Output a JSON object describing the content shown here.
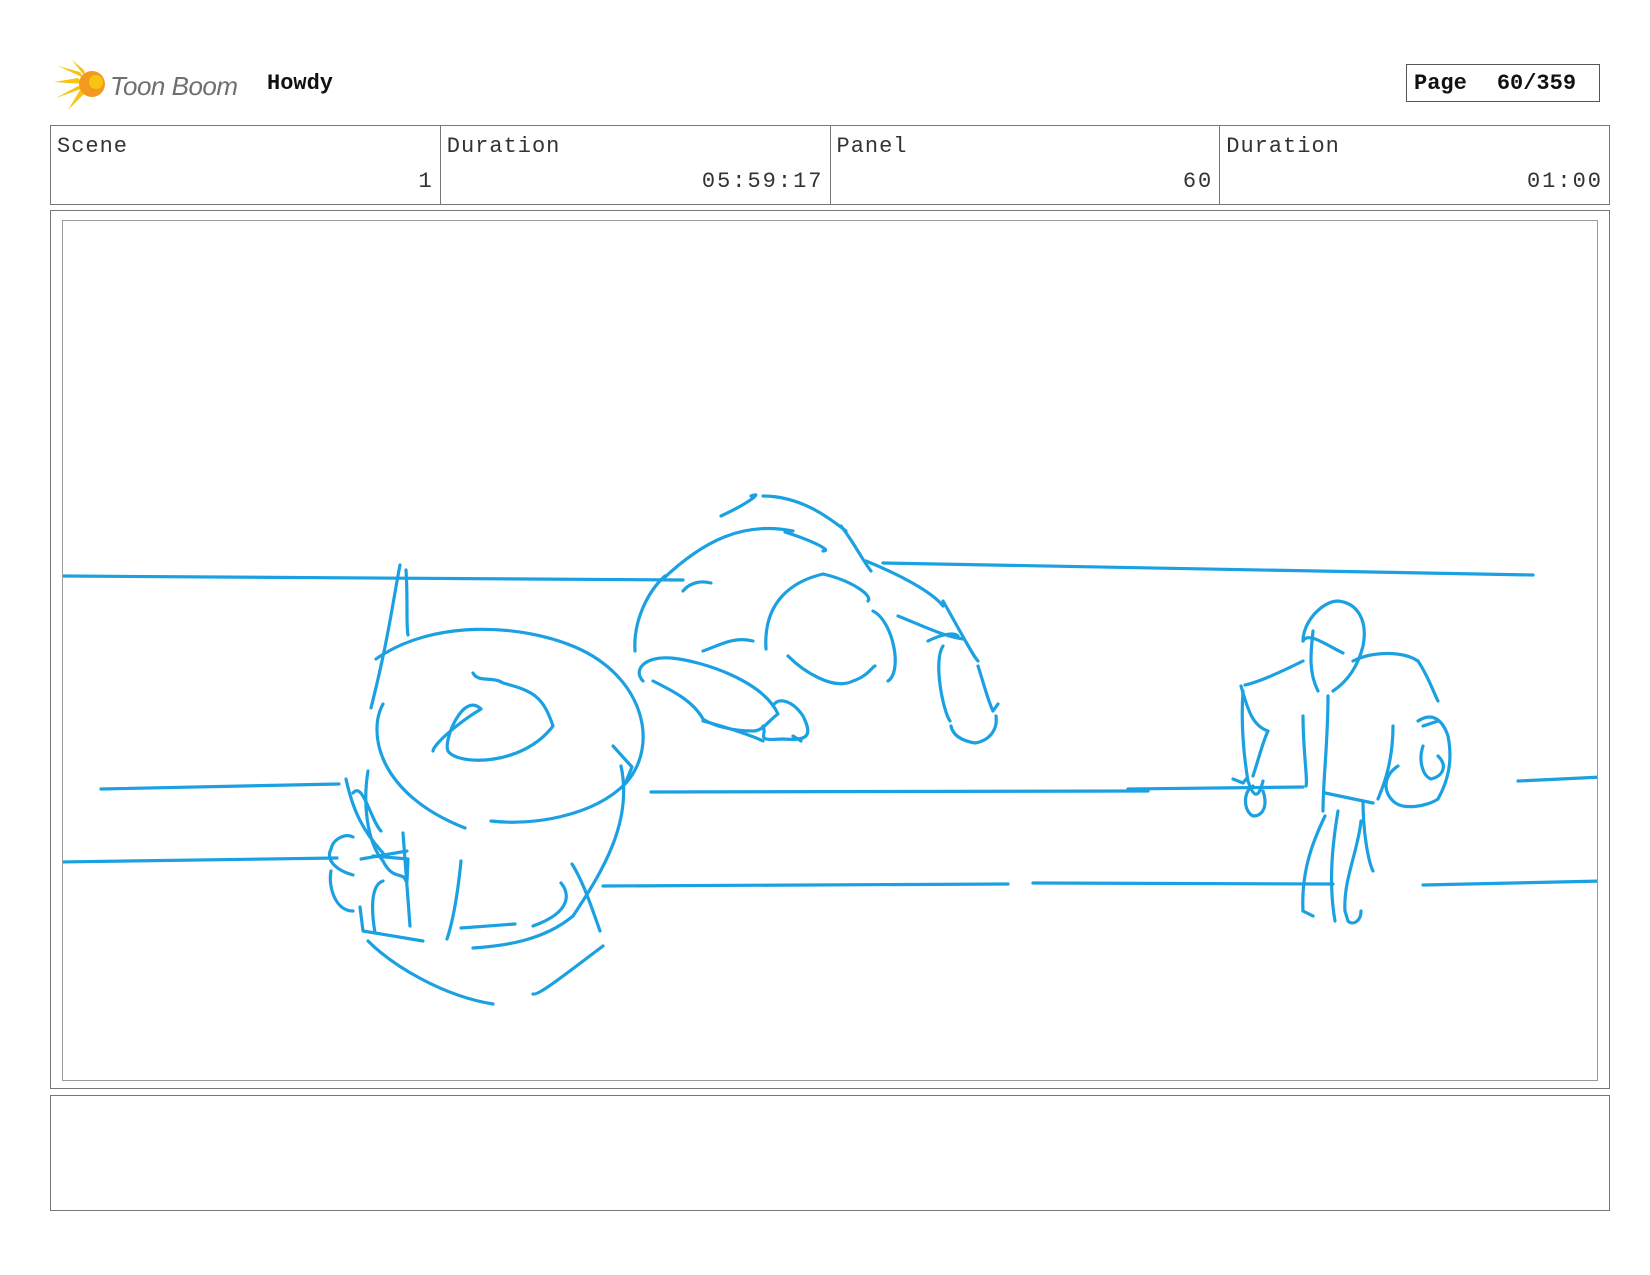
{
  "header": {
    "logo_text": "Toon Boom",
    "project_title": "Howdy",
    "page_label": "Page",
    "page_value": "60/359"
  },
  "info": {
    "scene_label": "Scene",
    "scene_value": "1",
    "scene_duration_label": "Duration",
    "scene_duration_value": "05:59:17",
    "panel_label": "Panel",
    "panel_value": "60",
    "panel_duration_label": "Duration",
    "panel_duration_value": "01:00"
  },
  "colors": {
    "sketch": "#1ba1e2",
    "logo_yellow": "#f7c413",
    "logo_orange": "#f39a1e",
    "border": "#777777"
  },
  "icons": {
    "logo": "toon-boom-burst-icon"
  },
  "notes": {
    "text": ""
  }
}
